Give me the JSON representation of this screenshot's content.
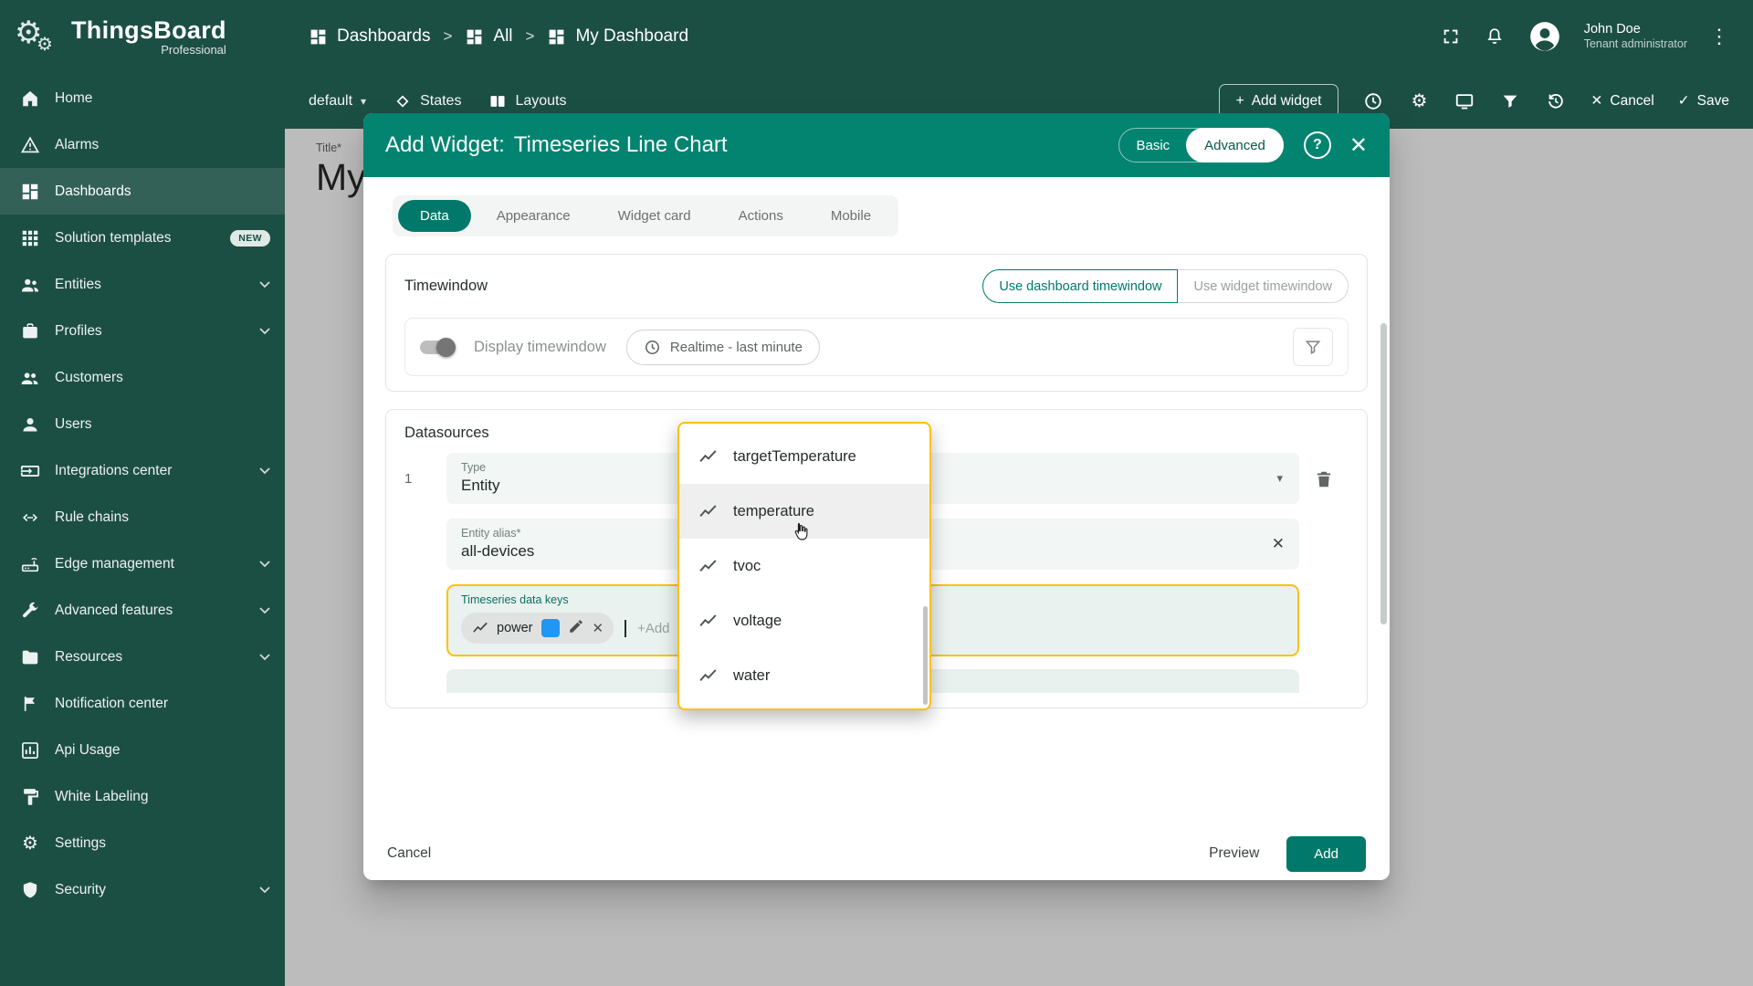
{
  "icons": {
    "close": "✕",
    "check": "✓",
    "caret_down": "▾",
    "kebab": "⋮",
    "gear": "⚙",
    "plus": "+",
    "help": "?",
    "crumb_sep": ">"
  },
  "colors": {
    "sidebar_bg": "#1c4f44",
    "modal_header": "#028471",
    "accent_teal": "#00796b",
    "highlight_amber": "#ffc107",
    "key_chip_color": "#2196f3"
  },
  "sidebar": {
    "logo_title": "ThingsBoard",
    "logo_subtitle": "Professional",
    "items": [
      {
        "label": "Home",
        "icon": "home-icon"
      },
      {
        "label": "Alarms",
        "icon": "alarms-icon"
      },
      {
        "label": "Dashboards",
        "icon": "dashboards-icon",
        "active": true
      },
      {
        "label": "Solution templates",
        "icon": "solution-templates-icon",
        "badge": "NEW"
      },
      {
        "label": "Entities",
        "icon": "entities-icon",
        "expandable": true
      },
      {
        "label": "Profiles",
        "icon": "profiles-icon",
        "expandable": true
      },
      {
        "label": "Customers",
        "icon": "customers-icon"
      },
      {
        "label": "Users",
        "icon": "users-icon"
      },
      {
        "label": "Integrations center",
        "icon": "integrations-center-icon",
        "expandable": true
      },
      {
        "label": "Rule chains",
        "icon": "rule-chains-icon"
      },
      {
        "label": "Edge management",
        "icon": "edge-management-icon",
        "expandable": true
      },
      {
        "label": "Advanced features",
        "icon": "advanced-features-icon",
        "expandable": true
      },
      {
        "label": "Resources",
        "icon": "resources-icon",
        "expandable": true
      },
      {
        "label": "Notification center",
        "icon": "notification-center-icon"
      },
      {
        "label": "Api Usage",
        "icon": "api-usage-icon"
      },
      {
        "label": "White Labeling",
        "icon": "white-labeling-icon"
      },
      {
        "label": "Settings",
        "icon": "settings-icon"
      },
      {
        "label": "Security",
        "icon": "security-icon",
        "expandable": true
      }
    ]
  },
  "header": {
    "breadcrumb": [
      "Dashboards",
      "All",
      "My Dashboard"
    ],
    "user": {
      "name": "John Doe",
      "role": "Tenant administrator"
    }
  },
  "toolbar": {
    "state_label": "default",
    "states_label": "States",
    "layouts_label": "Layouts",
    "add_widget_label": "Add widget",
    "cancel_label": "Cancel",
    "save_label": "Save"
  },
  "content": {
    "title_label": "Title*",
    "title_value": "My"
  },
  "modal": {
    "title_prefix": "Add Widget:",
    "title_widget": "Timeseries Line Chart",
    "basic_label": "Basic",
    "advanced_label": "Advanced",
    "tabs": [
      "Data",
      "Appearance",
      "Widget card",
      "Actions",
      "Mobile"
    ],
    "active_tab": "Data",
    "timewindow": {
      "heading": "Timewindow",
      "use_dashboard": "Use dashboard timewindow",
      "use_widget": "Use widget timewindow",
      "display_label": "Display timewindow",
      "realtime_label": "Realtime - last minute"
    },
    "datasources": {
      "heading": "Datasources",
      "row_index": "1",
      "type_label": "Type",
      "type_value": "Entity",
      "alias_label": "Entity alias*",
      "alias_value": "all-devices",
      "keys_label": "Timeseries data keys",
      "key_chip": "power",
      "chip_color": "#2196f3",
      "add_placeholder": "+Add"
    },
    "footer": {
      "cancel": "Cancel",
      "preview": "Preview",
      "add": "Add"
    }
  },
  "dropdown": {
    "options": [
      "targetTemperature",
      "temperature",
      "tvoc",
      "voltage",
      "water"
    ],
    "hovered": "temperature"
  }
}
